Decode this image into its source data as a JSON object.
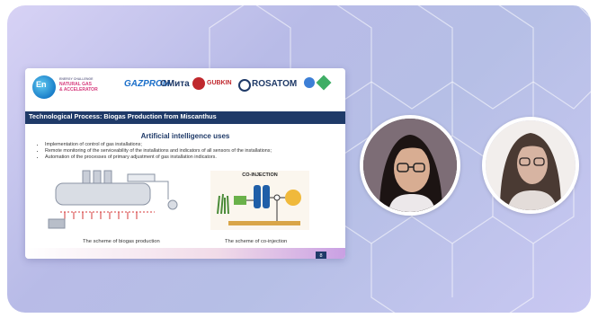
{
  "slide": {
    "logo_en": "En",
    "logo_line1": "ENERGY CHALLENGE",
    "logo_line2": "NATURAL GAS",
    "logo_line3": "& ACCELERATOR",
    "sponsors": [
      "GAZPROM",
      "ОМита",
      "GUBKIN",
      "ROSATOM"
    ],
    "title": "Technological Process: Biogas Production from Miscanthus",
    "subtitle": "Artificial intelligence uses",
    "bullets": [
      "Implementation of control of gas installations;",
      "Remote monitoring of the serviceability of the installations and indicators of all sensors of the installations;",
      "Automation of the processes of primary adjustment of gas installation indicators."
    ],
    "co_injection": "CO-INJECTION",
    "caption1": "The scheme of biogas production",
    "caption2": "The scheme of co-injection",
    "page": "8"
  },
  "colors": {
    "band": "#1f3a68",
    "accent": "#d63a7c"
  }
}
